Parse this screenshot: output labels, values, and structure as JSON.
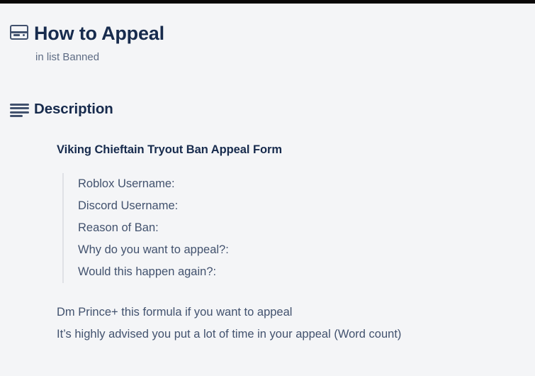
{
  "window": {
    "chrome_color": "#0a0708",
    "background_color": "#f4f5f7"
  },
  "card": {
    "icon": "card-window-icon",
    "title": "How to Appeal",
    "subtitle": "in list Banned",
    "list_name": "Banned"
  },
  "description": {
    "icon": "description-lines-icon",
    "section_title": "Description",
    "heading": "Viking Chieftain Tryout Ban Appeal Form",
    "quote_lines": [
      "Roblox Username:",
      "Discord Username:",
      "Reason of Ban:",
      "Why do you want to appeal?:",
      "Would this happen again?:"
    ],
    "paragraphs": [
      "Dm Prince+ this formula if you want to appeal",
      "It’s highly advised you put a lot of time in your appeal (Word count)"
    ]
  },
  "colors": {
    "heading_text": "#172b4d",
    "body_text": "#42526e",
    "subtle_text": "#5e6c84",
    "quote_border": "#dfe1e6",
    "page_background": "#f4f5f7"
  }
}
